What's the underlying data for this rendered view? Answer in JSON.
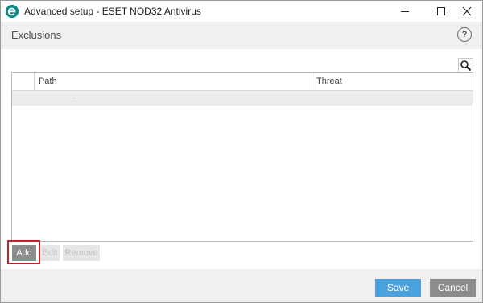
{
  "window": {
    "title": "Advanced setup - ESET NOD32 Antivirus",
    "logo_icon": "eset-logo-icon"
  },
  "header": {
    "title": "Exclusions",
    "help_label": "?"
  },
  "table": {
    "columns": [
      "",
      "Path",
      "Threat"
    ],
    "rows": [
      {
        "path": "",
        "threat": ""
      }
    ]
  },
  "actions": {
    "add_label": "Add",
    "edit_label": "Edit",
    "remove_label": "Remove"
  },
  "footer": {
    "save_label": "Save",
    "cancel_label": "Cancel"
  },
  "colors": {
    "accent": "#4aa3df",
    "highlight_border": "#c0242b",
    "button_gray": "#8c8c8c"
  }
}
